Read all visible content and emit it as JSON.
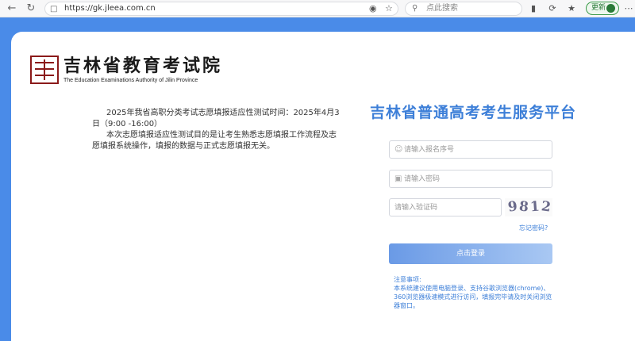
{
  "browser": {
    "url": "https://gk.jleea.com.cn",
    "search_placeholder": "点此搜索",
    "update_label": "更新"
  },
  "logo": {
    "cn": "吉林省教育考试院",
    "en": "The Education Examinations Authority of Jilin Province"
  },
  "notice": {
    "line1": "2025年我省高职分类考试志愿填报适应性测试时间：2025年4月3日（9:00 -16:00）",
    "line2": "本次志愿填报适应性测试目的是让考生熟悉志愿填报工作流程及志愿填报系统操作，填报的数据与正式志愿填报无关。"
  },
  "login": {
    "title": "吉林省普通高考考生服务平台",
    "username_placeholder": "请输入报名序号",
    "password_placeholder": "请输入密码",
    "captcha_placeholder": "请输入验证码",
    "captcha_chars": [
      "9",
      "8",
      "1",
      "2"
    ],
    "forgot_label": "忘记密码?",
    "submit_label": "点击登录"
  },
  "notes": {
    "heading": "注意事项:",
    "body": "本系统建议使用电脑登录、支持谷歌浏览器(chrome)、360浏览器极速模式进行访问，填报完毕请及时关闭浏览器窗口。"
  },
  "colors": {
    "accent": "#3d7fd8",
    "page_bg": "#4a8be8",
    "logo_red": "#8b1a1a"
  }
}
